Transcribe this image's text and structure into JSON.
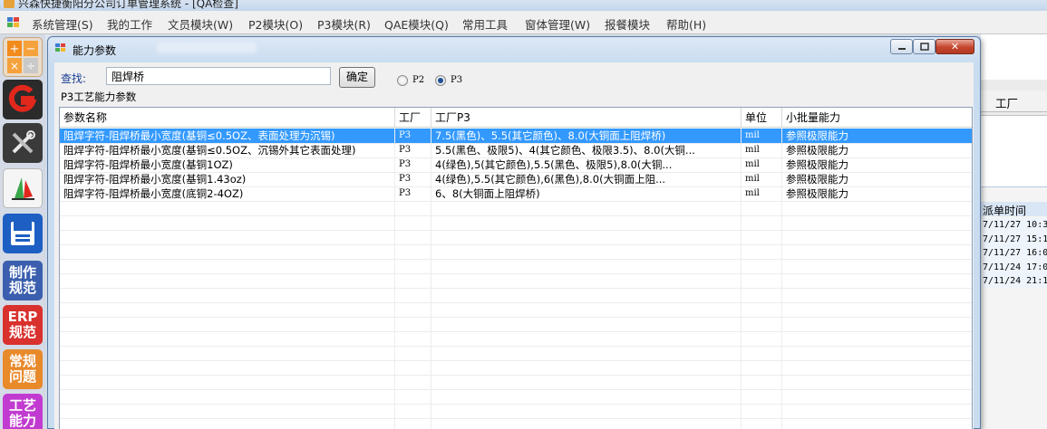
{
  "app": {
    "title": "兴森快捷衡阳分公司订单管理系统 - [QA检查]"
  },
  "menubar": {
    "items": [
      "系统管理(S)",
      "我的工作",
      "文员模块(W)",
      "P2模块(O)",
      "P3模块(R)",
      "QAE模块(Q)",
      "常用工具",
      "窗体管理(W)",
      "报餐模块",
      "帮助(H)"
    ]
  },
  "launcher": {
    "items": [
      {
        "label": "制作\n规范",
        "color": "#3b5fae"
      },
      {
        "label": "ERP\n规范",
        "color": "#d8312e"
      },
      {
        "label": "常规\n问题",
        "color": "#e8892a"
      },
      {
        "label": "工艺\n能力",
        "color": "#c13bd0"
      }
    ]
  },
  "bg_window": {
    "column_header": "工厂",
    "panel_header": "派单时间",
    "times": [
      "7/11/27 10:3",
      "7/11/27 15:1",
      "7/11/27 16:0",
      "7/11/24 17:0",
      "7/11/24 21:1"
    ]
  },
  "dialog": {
    "title": "能力参数",
    "search_label": "查找:",
    "search_value": "阻焊桥",
    "confirm_label": "确定",
    "radio_p2": "P2",
    "radio_p3": "P3",
    "selected_radio": "P3",
    "group_label": "P3工艺能力参数",
    "columns": [
      "参数名称",
      "工厂",
      "工厂P3",
      "单位",
      "小批量能力"
    ],
    "rows": [
      [
        "阻焊字符-阻焊桥最小宽度(基铜≤0.5OZ、表面处理为沉锡)",
        "P3",
        "7.5(黑色)、5.5(其它颜色)、8.0(大铜面上阻焊桥)",
        "mil",
        "参照极限能力"
      ],
      [
        "阻焊字符-阻焊桥最小宽度(基铜≤0.5OZ、沉锡外其它表面处理)",
        "P3",
        "5.5(黑色、极限5)、4(其它颜色、极限3.5)、8.0(大铜...",
        "mil",
        "参照极限能力"
      ],
      [
        "阻焊字符-阻焊桥最小宽度(基铜1OZ)",
        "P3",
        "4(绿色),5(其它颜色),5.5(黑色、极限5),8.0(大铜...",
        "mil",
        "参照极限能力"
      ],
      [
        "阻焊字符-阻焊桥最小宽度(基铜1.43oz)",
        "P3",
        "4(绿色),5.5(其它颜色),6(黑色),8.0(大铜面上阻...",
        "mil",
        "参照极限能力"
      ],
      [
        "阻焊字符-阻焊桥最小宽度(底铜2-4OZ)",
        "P3",
        "6、8(大铜面上阻焊桥)",
        "mil",
        "参照极限能力"
      ]
    ],
    "selected_row": 0
  },
  "colors": {
    "selection": "#3399ff",
    "dialog_border": "#5b7ca5",
    "close_button": "#c4452d"
  }
}
